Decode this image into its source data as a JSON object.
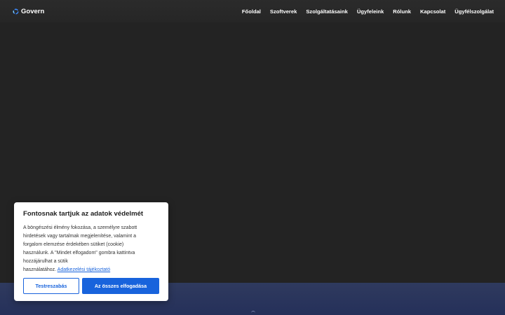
{
  "header": {
    "brand": "Govern",
    "nav": [
      {
        "label": "Főoldal"
      },
      {
        "label": "Szoftverek"
      },
      {
        "label": "Szolgáltatásaink"
      },
      {
        "label": "Ügyfeleink"
      },
      {
        "label": "Rólunk"
      },
      {
        "label": "Kapcsolat"
      },
      {
        "label": "Ügyfélszolgálat"
      }
    ]
  },
  "cookie_banner": {
    "title": "Fontosnak tartjuk az adatok védelmét",
    "text_line_1": "A böngészési élmény fokozása, a személyre szabott",
    "text_line_2": "hirdetések vagy tartalmak megjelenítése, valamint a",
    "text_line_3": "forgalom elemzése érdekében sütiket (cookie)",
    "text_line_4": "használunk. A \"Mindet elfogadom\" gombra kattintva",
    "text_line_5": "hozzájárulhat a sütik",
    "text_line_6": "használatához.",
    "policy_link": "Adatkezelési tájékoztató",
    "customize_label": "Testreszabás",
    "accept_all_label": "Az összes elfogadása"
  },
  "colors": {
    "accent": "#1863dc",
    "navbar": "#2a2a2a",
    "background": "#232323",
    "footer_band": "#2b365d"
  },
  "icons": {
    "brand": "govern-ring-logo-icon"
  }
}
